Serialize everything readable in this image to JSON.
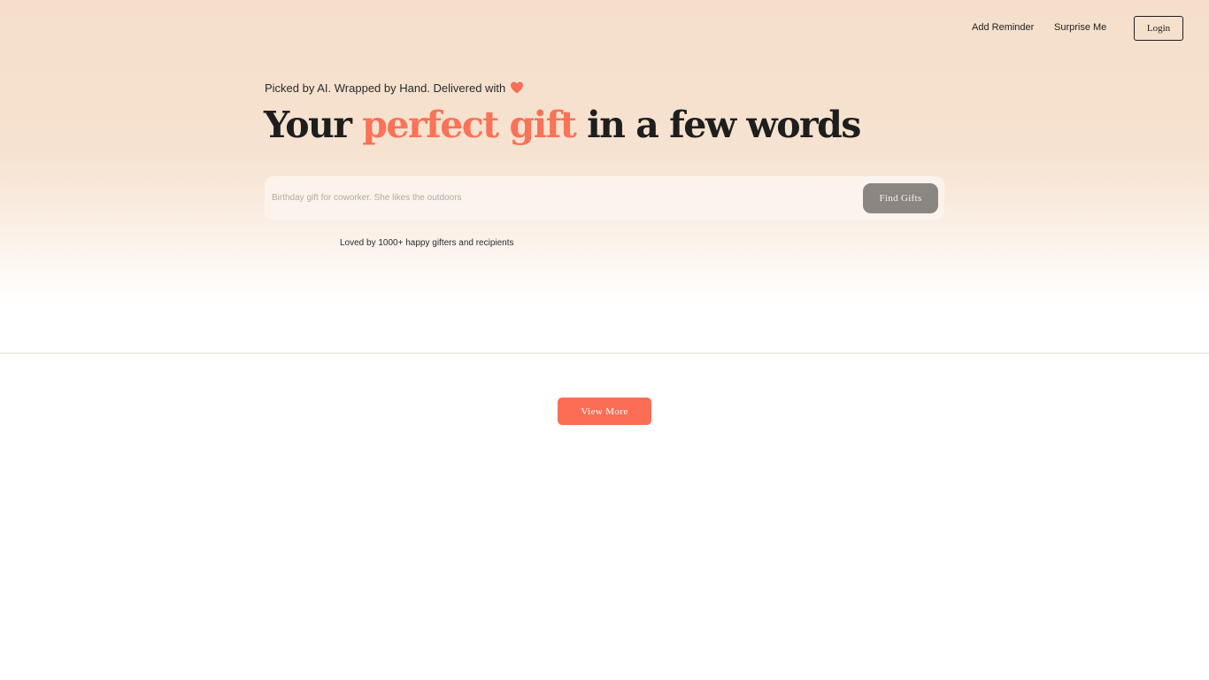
{
  "nav": {
    "add_reminder": "Add Reminder",
    "surprise_me": "Surprise Me",
    "login": "Login"
  },
  "hero": {
    "tagline": "Picked by AI. Wrapped by Hand. Delivered with",
    "tagline_icon": "heart-icon",
    "headline_start": "Your",
    "headline_accent": "perfect gift",
    "headline_end": "in a few words",
    "search_placeholder": "Birthday gift for coworker. She likes the outdoors",
    "search_value": "",
    "find_button": "Find Gifts",
    "social_proof": "Loved by 1000+ happy gifters and recipients"
  },
  "results": {
    "view_more": "View More"
  },
  "colors": {
    "accent": "#fa7257",
    "button_coral": "#fb6d55",
    "find_button": "#8b8682",
    "hero_bg": "#f5dfcb",
    "text": "#1e1e1e"
  }
}
